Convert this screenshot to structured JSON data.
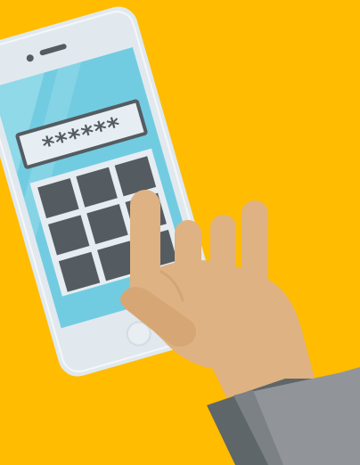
{
  "illustration": {
    "password_mask": "******",
    "keypad": {
      "rows": 3,
      "columns": 3,
      "key_count": 9
    }
  },
  "colors": {
    "background": "#FFBC00",
    "phone_body": "#E1E9EF",
    "phone_outline": "#DCE3E9",
    "screen": "#72CCE1",
    "password_field": "#E7EEF3",
    "password_border": "#555C61",
    "keypad_panel": "#E6EDF2",
    "key": "#555C61",
    "hand_skin": "#DEB283",
    "sleeve": "#919599",
    "cuff": "#5E6669"
  },
  "icons": {
    "earpiece": "phone-earpiece-icon",
    "camera": "phone-camera-icon",
    "home_button": "phone-home-button-icon"
  }
}
